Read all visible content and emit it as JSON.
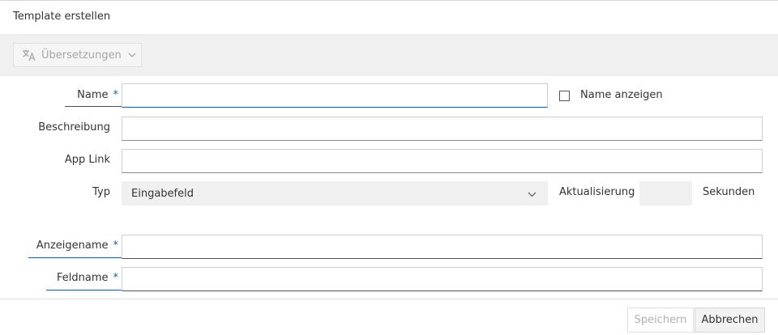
{
  "dialog": {
    "title": "Template erstellen"
  },
  "toolbar": {
    "translations_label": "Übersetzungen"
  },
  "form": {
    "name_label": "Name",
    "required_marker": "*",
    "show_name_label": "Name anzeigen",
    "description_label": "Beschreibung",
    "app_link_label": "App Link",
    "type_label": "Typ",
    "type_value": "Eingabefeld",
    "refresh_label": "Aktualisierung",
    "seconds_label": "Sekunden",
    "display_name_label": "Anzeigename",
    "field_name_label": "Feldname"
  },
  "footer": {
    "save_label": "Speichern",
    "cancel_label": "Abbrechen"
  },
  "colors": {
    "accent": "#1f5aa6",
    "toolbar_bg": "#f0f0f0"
  }
}
